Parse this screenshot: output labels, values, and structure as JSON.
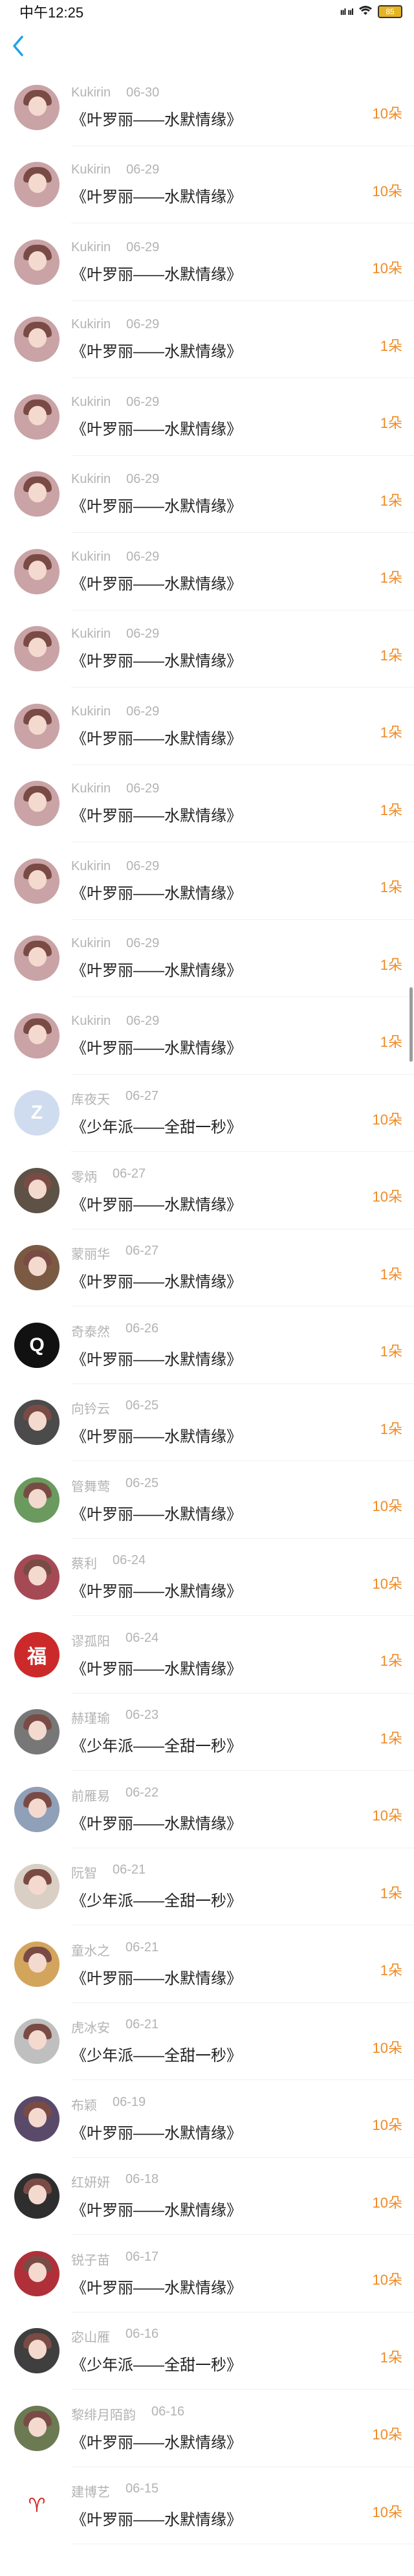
{
  "status_bar": {
    "time": "中午12:25",
    "signal": "ııl ııl",
    "wifi": "wifi",
    "battery": "85"
  },
  "nav": {
    "back_icon": "chevron-left-icon"
  },
  "rows": [
    {
      "user": "Kukirin",
      "date": "06-30",
      "title": "《叶罗丽——水默情缘》",
      "count": "10朵",
      "avatar": "#c9a3a5"
    },
    {
      "user": "Kukirin",
      "date": "06-29",
      "title": "《叶罗丽——水默情缘》",
      "count": "10朵",
      "avatar": "#c9a3a5"
    },
    {
      "user": "Kukirin",
      "date": "06-29",
      "title": "《叶罗丽——水默情缘》",
      "count": "10朵",
      "avatar": "#c9a3a5"
    },
    {
      "user": "Kukirin",
      "date": "06-29",
      "title": "《叶罗丽——水默情缘》",
      "count": "1朵",
      "avatar": "#c9a3a5"
    },
    {
      "user": "Kukirin",
      "date": "06-29",
      "title": "《叶罗丽——水默情缘》",
      "count": "1朵",
      "avatar": "#c9a3a5"
    },
    {
      "user": "Kukirin",
      "date": "06-29",
      "title": "《叶罗丽——水默情缘》",
      "count": "1朵",
      "avatar": "#c9a3a5"
    },
    {
      "user": "Kukirin",
      "date": "06-29",
      "title": "《叶罗丽——水默情缘》",
      "count": "1朵",
      "avatar": "#c9a3a5"
    },
    {
      "user": "Kukirin",
      "date": "06-29",
      "title": "《叶罗丽——水默情缘》",
      "count": "1朵",
      "avatar": "#c9a3a5"
    },
    {
      "user": "Kukirin",
      "date": "06-29",
      "title": "《叶罗丽——水默情缘》",
      "count": "1朵",
      "avatar": "#c9a3a5"
    },
    {
      "user": "Kukirin",
      "date": "06-29",
      "title": "《叶罗丽——水默情缘》",
      "count": "1朵",
      "avatar": "#c9a3a5"
    },
    {
      "user": "Kukirin",
      "date": "06-29",
      "title": "《叶罗丽——水默情缘》",
      "count": "1朵",
      "avatar": "#c9a3a5"
    },
    {
      "user": "Kukirin",
      "date": "06-29",
      "title": "《叶罗丽——水默情缘》",
      "count": "1朵",
      "avatar": "#c9a3a5"
    },
    {
      "user": "Kukirin",
      "date": "06-29",
      "title": "《叶罗丽——水默情缘》",
      "count": "1朵",
      "avatar": "#c9a3a5"
    },
    {
      "user": "库夜天",
      "date": "06-27",
      "title": "《少年派——全甜一秒》",
      "count": "10朵",
      "avatar": "#cfdcef",
      "glyph": "Z"
    },
    {
      "user": "零炳",
      "date": "06-27",
      "title": "《叶罗丽——水默情缘》",
      "count": "10朵",
      "avatar": "#5e5146"
    },
    {
      "user": "蒙丽华",
      "date": "06-27",
      "title": "《叶罗丽——水默情缘》",
      "count": "1朵",
      "avatar": "#7b5a43"
    },
    {
      "user": "奇泰然",
      "date": "06-26",
      "title": "《叶罗丽——水默情缘》",
      "count": "1朵",
      "avatar": "#111111",
      "glyph": "Q"
    },
    {
      "user": "向钤云",
      "date": "06-25",
      "title": "《叶罗丽——水默情缘》",
      "count": "1朵",
      "avatar": "#4b4b4b"
    },
    {
      "user": "管舞莺",
      "date": "06-25",
      "title": "《叶罗丽——水默情缘》",
      "count": "10朵",
      "avatar": "#6a9a5e"
    },
    {
      "user": "蔡利",
      "date": "06-24",
      "title": "《叶罗丽——水默情缘》",
      "count": "10朵",
      "avatar": "#a54a55"
    },
    {
      "user": "谬孤阳",
      "date": "06-24",
      "title": "《叶罗丽——水默情缘》",
      "count": "1朵",
      "avatar": "#cc2a2a",
      "glyph": "福"
    },
    {
      "user": "赫瑾瑜",
      "date": "06-23",
      "title": "《少年派——全甜一秒》",
      "count": "1朵",
      "avatar": "#777777"
    },
    {
      "user": "前雁易",
      "date": "06-22",
      "title": "《叶罗丽——水默情缘》",
      "count": "10朵",
      "avatar": "#8fa0b8"
    },
    {
      "user": "阮智",
      "date": "06-21",
      "title": "《少年派——全甜一秒》",
      "count": "1朵",
      "avatar": "#d9cfc4"
    },
    {
      "user": "童水之",
      "date": "06-21",
      "title": "《叶罗丽——水默情缘》",
      "count": "1朵",
      "avatar": "#d3a45c"
    },
    {
      "user": "虎冰安",
      "date": "06-21",
      "title": "《少年派——全甜一秒》",
      "count": "10朵",
      "avatar": "#bfbfbf"
    },
    {
      "user": "布颖",
      "date": "06-19",
      "title": "《叶罗丽——水默情缘》",
      "count": "10朵",
      "avatar": "#5a4a6a"
    },
    {
      "user": "红妍妍",
      "date": "06-18",
      "title": "《叶罗丽——水默情缘》",
      "count": "10朵",
      "avatar": "#2e2e2e"
    },
    {
      "user": "锐子苗",
      "date": "06-17",
      "title": "《叶罗丽——水默情缘》",
      "count": "10朵",
      "avatar": "#b0303a"
    },
    {
      "user": "宓山雁",
      "date": "06-16",
      "title": "《少年派——全甜一秒》",
      "count": "1朵",
      "avatar": "#3f3f3f"
    },
    {
      "user": "黎绯月陌韵",
      "date": "06-16",
      "title": "《叶罗丽——水默情缘》",
      "count": "10朵",
      "avatar": "#6b7a52"
    },
    {
      "user": "建博艺",
      "date": "06-15",
      "title": "《叶罗丽——水默情缘》",
      "count": "10朵",
      "avatar": "#ffffff",
      "glyph": "♈",
      "glyphColor": "#d62b2b"
    }
  ]
}
